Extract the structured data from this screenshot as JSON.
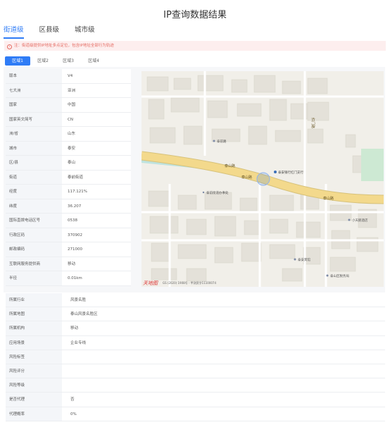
{
  "title": "IP查询数据结果",
  "level_tabs": [
    {
      "label": "街道级",
      "active": true
    },
    {
      "label": "区县级",
      "active": false
    },
    {
      "label": "城市级",
      "active": false
    }
  ],
  "warning": {
    "icon": "info-icon",
    "text": "注：街道级提供IP地址多点定位，包含IP地址全部行为轨迹"
  },
  "region_tabs": [
    {
      "label": "区域1",
      "active": true
    },
    {
      "label": "区域2",
      "active": false
    },
    {
      "label": "区域3",
      "active": false
    },
    {
      "label": "区域4",
      "active": false
    }
  ],
  "info_rows": [
    {
      "key": "版本",
      "value": "V4"
    },
    {
      "key": "七大洲",
      "value": "亚洲"
    },
    {
      "key": "国家",
      "value": "中国"
    },
    {
      "key": "国家英文简写",
      "value": "CN"
    },
    {
      "key": "洲/省",
      "value": "山东"
    },
    {
      "key": "城市",
      "value": "泰安"
    },
    {
      "key": "区/县",
      "value": "泰山"
    },
    {
      "key": "街道",
      "value": "泰前街道"
    },
    {
      "key": "经度",
      "value": "117.121%"
    },
    {
      "key": "纬度",
      "value": "36.207"
    },
    {
      "key": "国际直拨电话区号",
      "value": "0538"
    },
    {
      "key": "行政区码",
      "value": "370902"
    },
    {
      "key": "邮政编码",
      "value": "271000"
    },
    {
      "key": "互联网服务提供商",
      "value": "移动"
    },
    {
      "key": "半径",
      "value": "0.01km"
    }
  ],
  "map": {
    "labels": {
      "bank": "泰安银行红门支行",
      "road1": "泰山路",
      "road2": "泰山路",
      "road3": "泰山路",
      "poi1": "泰前街道办事处",
      "poi2": "小天鹅酒店",
      "poi3": "泰安宾馆",
      "poi4": "泰山区税务局",
      "poi5": "泰前路",
      "side_road": "红门路"
    },
    "copyright": "GS (2020) 1908号 - 甲测资字11100074",
    "logo": "天地图",
    "colors": {
      "road": "#f3d98c",
      "water": "#bfe3df",
      "park": "#cde9d3"
    }
  },
  "risk_rows": [
    {
      "key": "所属行业",
      "value": "风景名胜"
    },
    {
      "key": "所属地图",
      "value": "泰山风景名胜区"
    },
    {
      "key": "所属机构",
      "value": "移动"
    },
    {
      "key": "应用场景",
      "value": "企业专线"
    },
    {
      "key": "风险标签",
      "value": ""
    },
    {
      "key": "风险评分",
      "value": ""
    },
    {
      "key": "风险等级",
      "value": ""
    },
    {
      "key": "是否代理",
      "value": "否"
    },
    {
      "key": "代理概率",
      "value": "0%"
    }
  ],
  "colors": {
    "accent": "#2f7cf6",
    "warning_bg": "#fdeeee",
    "warning_text": "#e56b62"
  }
}
